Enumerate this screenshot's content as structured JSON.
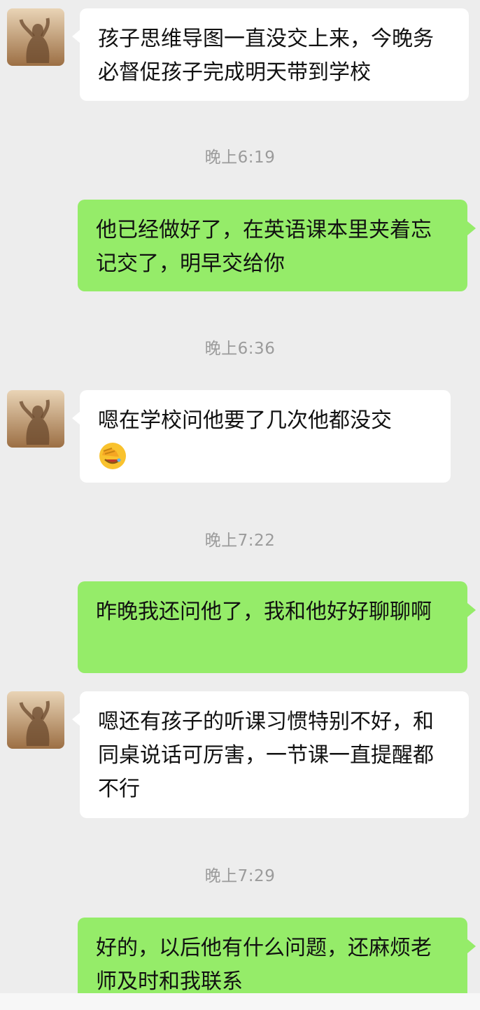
{
  "messages": [
    {
      "side": "in",
      "text": "孩子思维导图一直没交上来，今晚务必督促孩子完成明天带到学校"
    },
    {
      "time": "晚上6:19"
    },
    {
      "side": "out",
      "text": "他已经做好了，在英语课本里夹着忘记交了，明早交给你"
    },
    {
      "time": "晚上6:36"
    },
    {
      "side": "in",
      "text": "嗯在学校问他要了几次他都没交",
      "emoji": "facepalm-emoji"
    },
    {
      "time": "晚上7:22"
    },
    {
      "side": "out",
      "text": "昨晚我还问他了，我和他好好聊聊啊"
    },
    {
      "side": "in",
      "text": "嗯还有孩子的听课习惯特别不好，和同桌说话可厉害，一节课一直提醒都不行"
    },
    {
      "time": "晚上7:29"
    },
    {
      "side": "out",
      "text": "好的，以后他有什么问题，还麻烦老师及时和我联系"
    }
  ],
  "colors": {
    "background": "#ededed",
    "incoming_bubble": "#ffffff",
    "outgoing_bubble": "#95ec69",
    "timestamp": "#9b9b9b"
  }
}
